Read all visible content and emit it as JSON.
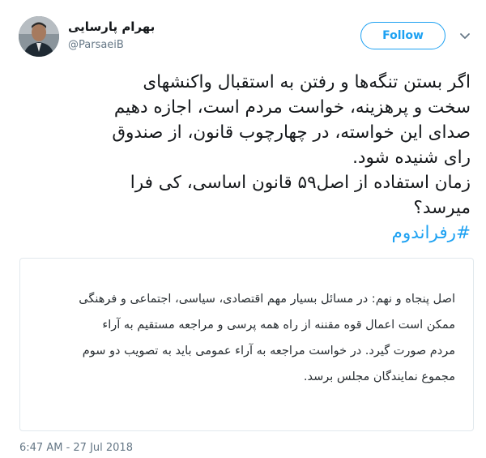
{
  "user": {
    "display_name": "بهرام پارسایی",
    "handle": "@ParsaeiB"
  },
  "follow_button": {
    "label": "Follow"
  },
  "tweet": {
    "lines": [
      "اگر بستن تنگه‌ها و رفتن به استقبال واکنشهای",
      "سخت و پرهزینه، خواست مردم است، اجازه دهیم",
      "صدای این خواسته، در چهارچوب قانون، از صندوق",
      "رای شنیده شود.",
      "زمان استفاده از اصل۵۹ قانون اساسی، کی فرا",
      "میرسد؟"
    ],
    "hashtag": "#رفراندوم"
  },
  "quote": {
    "lines": [
      "اصل پنجاه و نهم: در مسائل بسیار مهم اقتصادی، سیاسی، اجتماعی و فرهنگی",
      "ممکن است اعمال قوه مقننه از راه همه پرسی و مراجعه مستقیم به آراء",
      "مردم صورت گیرد. در خواست مراجعه به آراء عمومی باید به تصویب دو سوم",
      "مجموع نمایندگان مجلس برسد."
    ]
  },
  "timestamp": "6:47 AM - 27 Jul 2018",
  "icons": {
    "caret": "chevron-down-icon"
  },
  "colors": {
    "accent": "#1da1f2",
    "text": "#14171a",
    "muted": "#657786",
    "border": "#e1e8ed"
  }
}
